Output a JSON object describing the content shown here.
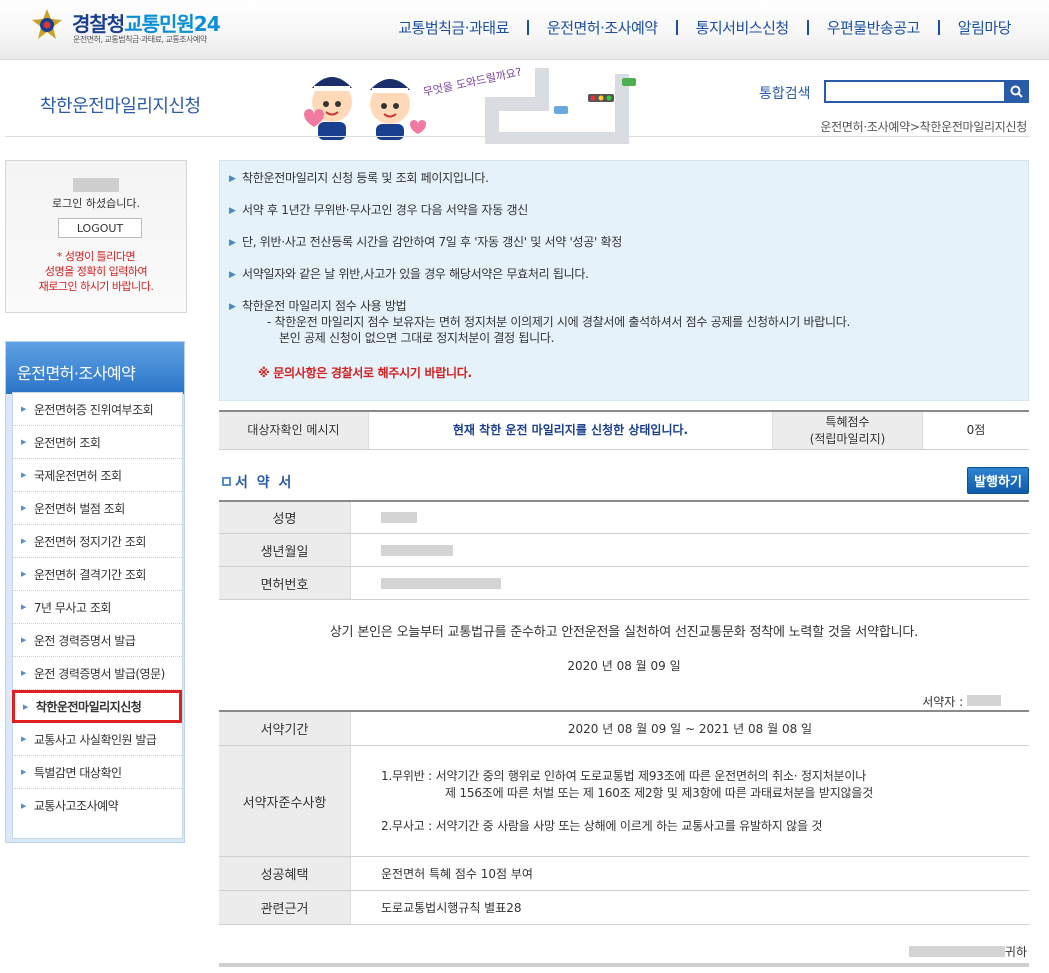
{
  "header": {
    "logo_main": "경찰청",
    "logo_accent": "교통민원24",
    "logo_sub": "운전면허, 교통범칙금·과태료, 교통조사예약",
    "gnb": [
      "교통범칙금·과태료",
      "운전면허·조사예약",
      "통지서비스신청",
      "우편물반송공고",
      "알림마당"
    ]
  },
  "page": {
    "title": "착한운전마일리지신청",
    "mascot_text": "무엇을 도와드릴까요?",
    "search_label": "통합검색",
    "breadcrumb": "운전면허·조사예약>착한운전마일리지신청"
  },
  "login": {
    "greeting": "로그인 하셨습니다.",
    "logout_label": "LOGOUT",
    "notice": [
      "* 성명이 틀리다면",
      "성명을 정확히 입력하여",
      "재로그인 하시기 바랍니다."
    ]
  },
  "sidenav": {
    "title": "운전면허·조사예약",
    "items": [
      "운전면허증 진위여부조회",
      "운전면허 조회",
      "국제운전면허 조회",
      "운전면허 벌점 조회",
      "운전면허 정지기간 조회",
      "운전면허 결격기간 조회",
      "7년 무사고 조회",
      "운전 경력증명서 발급",
      "운전 경력증명서 발급(영문)",
      "착한운전마일리지신청",
      "교통사고 사실확인원 발급",
      "특별감면 대상확인",
      "교통사고조사예약"
    ]
  },
  "info": {
    "item1": "착한운전마일리지 신청 등록 및 조회 페이지입니다.",
    "item2": "서약 후 1년간 무위반·무사고인 경우 다음 서약을 자동 갱신",
    "item3": "단, 위반·사고 전산등록 시간을 감안하여 7일 후 '자동 갱신' 및 서약 '성공' 확정",
    "item4": "서약일자와 같은 날 위반,사고가 있을 경우 해당서약은 무효처리 됩니다.",
    "item5": "착한운전 마일리지 점수 사용 방법",
    "item5_sub1": "- 착한운전 마일리지 점수 보유자는 면허 정지처분 이의제기 시에 경찰서에 출석하셔서 점수 공제를 신청하시기 바랍니다.",
    "item5_sub2": "본인 공제 신청이 없으면 그대로 정지처분이 결정 됩니다.",
    "warning": "※ 문의사항은 경찰서로 해주시기 바랍니다."
  },
  "status": {
    "label": "대상자확인 메시지",
    "message": "현재 착한 운전 마일리지를 신청한 상태입니다.",
    "points_label_1": "특혜점수",
    "points_label_2": "(적립마일리지)",
    "points_value": "0점"
  },
  "pledge": {
    "title": "서 약 서",
    "issue_button": "발행하기",
    "name_label": "성명",
    "birth_label": "생년월일",
    "license_label": "면허번호",
    "statement": "상기 본인은 오늘부터 교통법규를 준수하고 안전운전을 실천하여 선진교통문화 정착에 노력할 것을 서약합니다.",
    "date": "2020 년 08 월 09 일",
    "signer_label": "서약자 :",
    "period_label": "서약기간",
    "period_value": "2020 년 08 월 09 일 ~ 2021 년 08 월 08 일",
    "conditions_label": "서약자준수사항",
    "cond1_line1": "1.무위반 : 서약기간 중의 행위로 인하여 도로교통법 제93조에 따른 운전면허의 취소· 정지처분이나",
    "cond1_line2": "제 156조에 따른 처벌 또는 제 160조 제2항 및 제3항에 따른 과태료처분을 받지않을것",
    "cond2": "2.무사고 : 서약기간 중 사람을 사망 또는 상해에 이르게 하는 교통사고를 유발하지 않을 것",
    "benefit_label": "성공혜택",
    "benefit_value": "운전면허 특혜 점수 10점 부여",
    "basis_label": "관련근거",
    "basis_value": "도로교통법시행규칙 별표28",
    "recipient_suffix": "귀하"
  }
}
